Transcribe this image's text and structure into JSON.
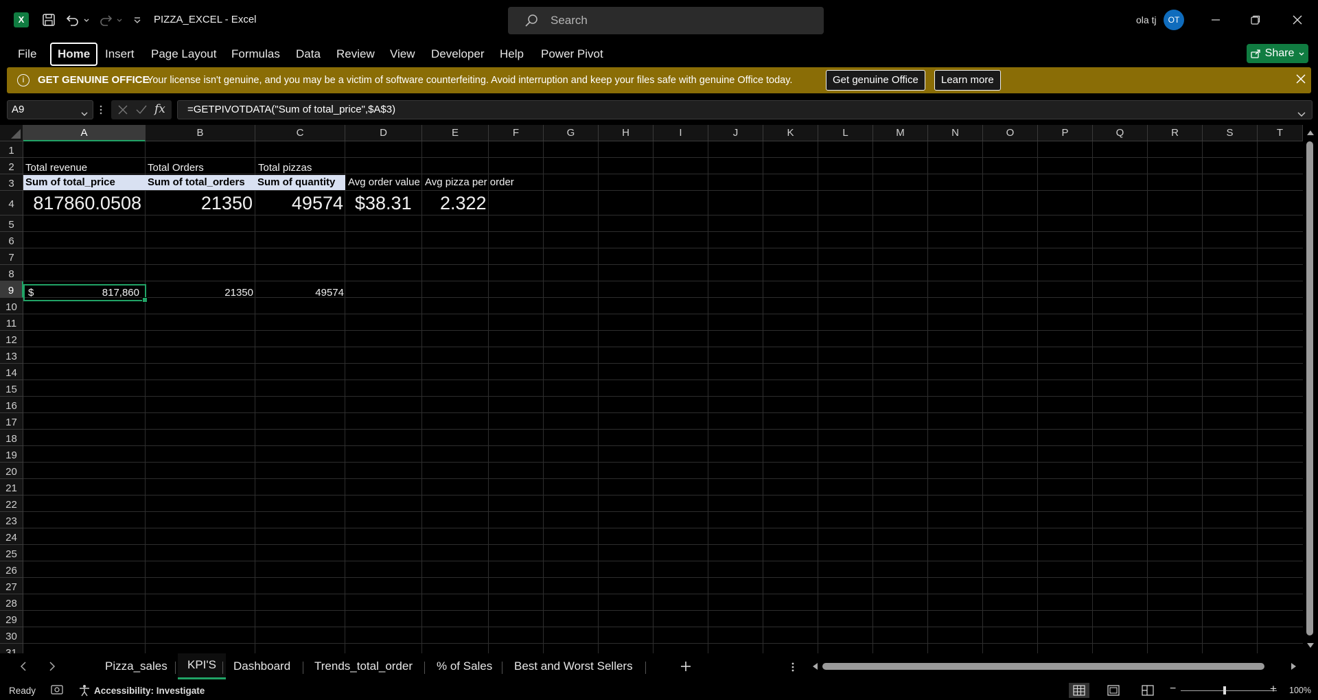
{
  "titlebar": {
    "doc_title": "PIZZA_EXCEL  -  Excel",
    "search_placeholder": "Search",
    "user_name": "ola tj",
    "user_initials": "OT"
  },
  "ribbon": {
    "tabs": [
      "File",
      "Home",
      "Insert",
      "Page Layout",
      "Formulas",
      "Data",
      "Review",
      "View",
      "Developer",
      "Help",
      "Power Pivot"
    ],
    "active_tab": "Home",
    "share_label": "Share"
  },
  "banner": {
    "title": "GET GENUINE OFFICE",
    "message": "Your license isn't genuine, and you may be a victim of software counterfeiting. Avoid interruption and keep your files safe with genuine Office today.",
    "btn_genuine": "Get genuine Office",
    "btn_learn": "Learn more"
  },
  "formula_bar": {
    "name_box": "A9",
    "formula": "=GETPIVOTDATA(\"Sum of total_price\",$A$3)"
  },
  "grid": {
    "columns": [
      "A",
      "B",
      "C",
      "D",
      "E",
      "F",
      "G",
      "H",
      "I",
      "J",
      "K",
      "L",
      "M",
      "N",
      "O",
      "P",
      "Q",
      "R",
      "S",
      "T"
    ],
    "selected_column": "A",
    "rows": [
      "1",
      "2",
      "3",
      "4",
      "5",
      "6",
      "7",
      "8",
      "9",
      "10",
      "11",
      "12",
      "13",
      "14",
      "15",
      "16",
      "17",
      "18",
      "19",
      "20",
      "21",
      "22",
      "23",
      "24",
      "25",
      "26",
      "27",
      "28",
      "29",
      "30",
      "31"
    ],
    "selected_row": "9",
    "cells": {
      "A2": "Total revenue",
      "B2": "Total Orders",
      "C2": "Total pizzas",
      "A3": "Sum of total_price",
      "B3": "Sum of total_orders",
      "C3": "Sum of quantity",
      "D3": "Avg order value",
      "E3": "Avg  pizza per order",
      "A4": "817860.0508",
      "B4": "21350",
      "C4": "49574",
      "D4": "$38.31",
      "E4": "2.322",
      "A9_symbol": "$",
      "A9_value": "817,860",
      "B9": "21350",
      "C9": "49574"
    }
  },
  "sheets": {
    "tabs": [
      "Pizza_sales",
      "KPI'S",
      "Dashboard",
      "Trends_total_order",
      "% of Sales",
      "Best and Worst Sellers"
    ],
    "active": "KPI'S"
  },
  "status": {
    "ready": "Ready",
    "accessibility": "Accessibility: Investigate",
    "zoom": "100%"
  },
  "colors": {
    "accent_green": "#107c41",
    "selection_green": "#21a366",
    "banner_bg": "#8a6d06",
    "pivot_header_bg": "#d9e1f2",
    "avatar_bg": "#0f6cbd"
  },
  "icons": [
    "excel-logo-icon",
    "save-icon",
    "undo-icon",
    "redo-icon",
    "customize-qat-icon",
    "search-icon",
    "minimize-icon",
    "restore-icon",
    "close-icon",
    "info-icon",
    "cancel-icon",
    "enter-icon",
    "fx-icon",
    "chevron-down-icon",
    "add-sheet-icon",
    "normal-view-icon",
    "page-layout-view-icon",
    "page-break-view-icon"
  ]
}
